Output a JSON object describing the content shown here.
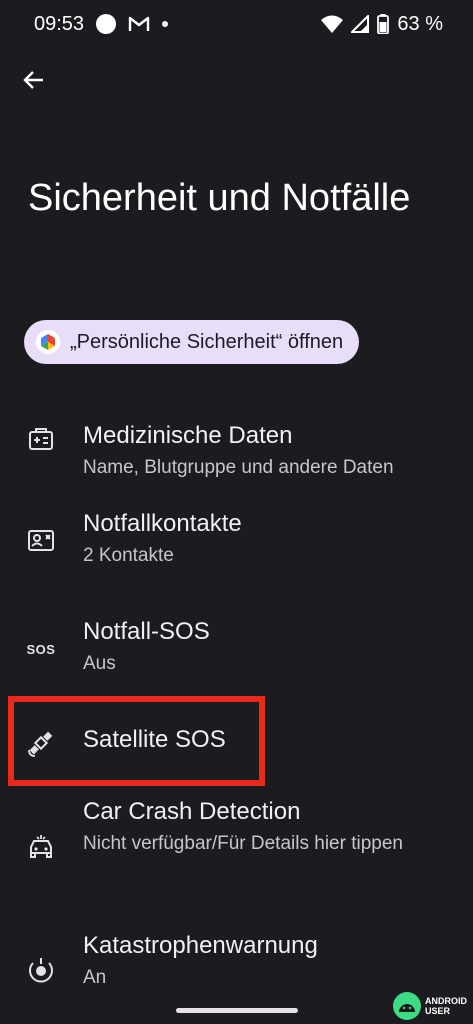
{
  "status_bar": {
    "time": "09:53",
    "battery": "63 %",
    "notification_icons": [
      "circle-icon",
      "gmail-icon",
      "dot-icon"
    ],
    "system_icons": [
      "wifi-icon",
      "signal-icon",
      "battery-icon"
    ]
  },
  "header": {
    "back_icon": "back-arrow-icon",
    "title": "Sicherheit und Notfälle"
  },
  "chip": {
    "label": "„Persönliche Sicherheit“ öffnen",
    "icon": "personal-safety-icon"
  },
  "items": [
    {
      "title": "Medizinische Daten",
      "subtitle": "Name, Blutgruppe und andere Daten",
      "icon": "medical-info-icon"
    },
    {
      "title": "Notfallkontakte",
      "subtitle": "2 Kontakte",
      "icon": "contact-card-icon"
    },
    {
      "title": "Notfall-SOS",
      "subtitle": "Aus",
      "icon": "sos-icon",
      "icon_text": "SOS"
    },
    {
      "title": "Satellite SOS",
      "subtitle": "",
      "icon": "satellite-icon"
    },
    {
      "title": "Car Crash Detection",
      "subtitle": "Nicht verfügbar/Für Details hier tippen",
      "icon": "car-crash-icon"
    },
    {
      "title": "Katastrophenwarnung",
      "subtitle": "An",
      "icon": "emergency-alert-icon"
    }
  ],
  "watermark": {
    "line1": "ANDROID",
    "line2": "USER"
  },
  "colors": {
    "background": "#1c1b1f",
    "chip_background": "#e8def8",
    "highlight": "#e8291c",
    "watermark_green": "#3ddc84"
  }
}
